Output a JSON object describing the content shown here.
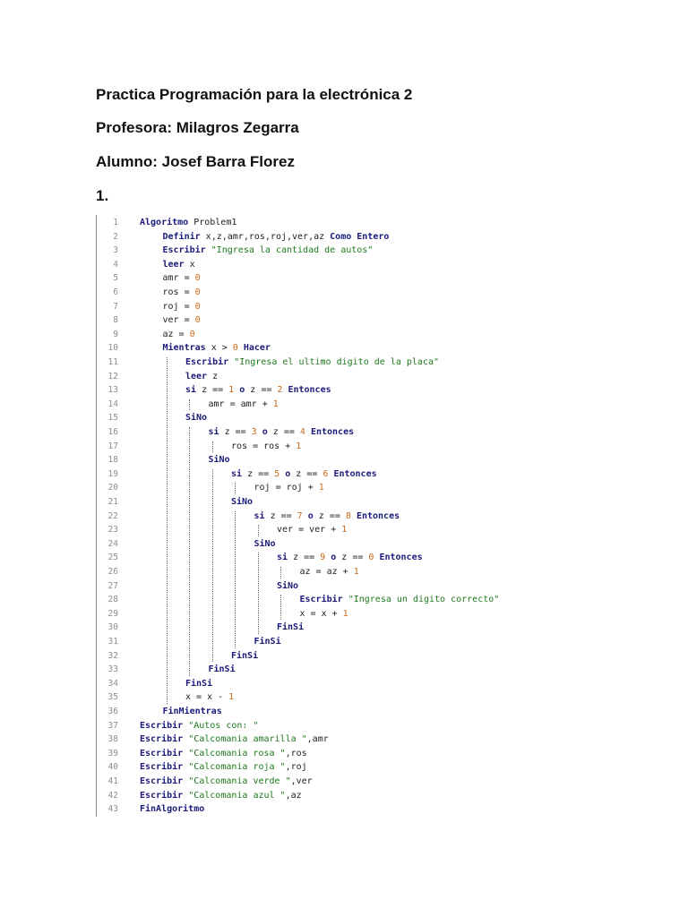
{
  "document": {
    "title": "Practica Programación para la electrónica 2",
    "teacher": "Profesora: Milagros Zegarra",
    "student": "Alumno: Josef Barra Florez",
    "item_number": "1."
  },
  "code": {
    "lines": [
      {
        "n": "1",
        "indent": 0,
        "tokens": [
          [
            "kw",
            "Algoritmo"
          ],
          [
            "id",
            " Problem1"
          ]
        ]
      },
      {
        "n": "2",
        "indent": 1,
        "tokens": [
          [
            "kw",
            "Definir"
          ],
          [
            "id",
            " x,z,amr,ros,roj,ver,az "
          ],
          [
            "kw",
            "Como Entero"
          ]
        ]
      },
      {
        "n": "3",
        "indent": 1,
        "tokens": [
          [
            "kw",
            "Escribir"
          ],
          [
            "id",
            " "
          ],
          [
            "str",
            "\"Ingresa la cantidad de autos\""
          ]
        ]
      },
      {
        "n": "4",
        "indent": 1,
        "tokens": [
          [
            "kw",
            "leer"
          ],
          [
            "id",
            " x"
          ]
        ]
      },
      {
        "n": "5",
        "indent": 1,
        "tokens": [
          [
            "id",
            "amr = "
          ],
          [
            "num",
            "0"
          ]
        ]
      },
      {
        "n": "6",
        "indent": 1,
        "tokens": [
          [
            "id",
            "ros = "
          ],
          [
            "num",
            "0"
          ]
        ]
      },
      {
        "n": "7",
        "indent": 1,
        "tokens": [
          [
            "id",
            "roj = "
          ],
          [
            "num",
            "0"
          ]
        ]
      },
      {
        "n": "8",
        "indent": 1,
        "tokens": [
          [
            "id",
            "ver = "
          ],
          [
            "num",
            "0"
          ]
        ]
      },
      {
        "n": "9",
        "indent": 1,
        "tokens": [
          [
            "id",
            "az = "
          ],
          [
            "num",
            "0"
          ]
        ]
      },
      {
        "n": "10",
        "indent": 1,
        "tokens": [
          [
            "kw",
            "Mientras"
          ],
          [
            "id",
            " x > "
          ],
          [
            "num",
            "0"
          ],
          [
            "id",
            " "
          ],
          [
            "kw",
            "Hacer"
          ]
        ]
      },
      {
        "n": "11",
        "indent": 2,
        "tokens": [
          [
            "kw",
            "Escribir"
          ],
          [
            "id",
            " "
          ],
          [
            "str",
            "\"Ingresa el ultimo digito de la placa\""
          ]
        ]
      },
      {
        "n": "12",
        "indent": 2,
        "tokens": [
          [
            "kw",
            "leer"
          ],
          [
            "id",
            " z"
          ]
        ]
      },
      {
        "n": "13",
        "indent": 2,
        "tokens": [
          [
            "kw",
            "si"
          ],
          [
            "id",
            " z == "
          ],
          [
            "num",
            "1"
          ],
          [
            "id",
            " "
          ],
          [
            "kw",
            "o"
          ],
          [
            "id",
            " z == "
          ],
          [
            "num",
            "2"
          ],
          [
            "id",
            " "
          ],
          [
            "kw",
            "Entonces"
          ]
        ]
      },
      {
        "n": "14",
        "indent": 3,
        "tokens": [
          [
            "id",
            "amr = amr + "
          ],
          [
            "num",
            "1"
          ]
        ]
      },
      {
        "n": "15",
        "indent": 2,
        "tokens": [
          [
            "kw",
            "SiNo"
          ]
        ]
      },
      {
        "n": "16",
        "indent": 3,
        "tokens": [
          [
            "kw",
            "si"
          ],
          [
            "id",
            " z == "
          ],
          [
            "num",
            "3"
          ],
          [
            "id",
            " "
          ],
          [
            "kw",
            "o"
          ],
          [
            "id",
            " z == "
          ],
          [
            "num",
            "4"
          ],
          [
            "id",
            " "
          ],
          [
            "kw",
            "Entonces"
          ]
        ]
      },
      {
        "n": "17",
        "indent": 4,
        "tokens": [
          [
            "id",
            "ros = ros + "
          ],
          [
            "num",
            "1"
          ]
        ]
      },
      {
        "n": "18",
        "indent": 3,
        "tokens": [
          [
            "kw",
            "SiNo"
          ]
        ]
      },
      {
        "n": "19",
        "indent": 4,
        "tokens": [
          [
            "kw",
            "si"
          ],
          [
            "id",
            " z == "
          ],
          [
            "num",
            "5"
          ],
          [
            "id",
            " "
          ],
          [
            "kw",
            "o"
          ],
          [
            "id",
            " z == "
          ],
          [
            "num",
            "6"
          ],
          [
            "id",
            " "
          ],
          [
            "kw",
            "Entonces"
          ]
        ]
      },
      {
        "n": "20",
        "indent": 5,
        "tokens": [
          [
            "id",
            "roj = roj + "
          ],
          [
            "num",
            "1"
          ]
        ]
      },
      {
        "n": "21",
        "indent": 4,
        "tokens": [
          [
            "kw",
            "SiNo"
          ]
        ]
      },
      {
        "n": "22",
        "indent": 5,
        "tokens": [
          [
            "kw",
            "si"
          ],
          [
            "id",
            " z == "
          ],
          [
            "num",
            "7"
          ],
          [
            "id",
            " "
          ],
          [
            "kw",
            "o"
          ],
          [
            "id",
            " z == "
          ],
          [
            "num",
            "8"
          ],
          [
            "id",
            " "
          ],
          [
            "kw",
            "Entonces"
          ]
        ]
      },
      {
        "n": "23",
        "indent": 6,
        "tokens": [
          [
            "id",
            "ver = ver + "
          ],
          [
            "num",
            "1"
          ]
        ]
      },
      {
        "n": "24",
        "indent": 5,
        "tokens": [
          [
            "kw",
            "SiNo"
          ]
        ]
      },
      {
        "n": "25",
        "indent": 6,
        "tokens": [
          [
            "kw",
            "si"
          ],
          [
            "id",
            " z == "
          ],
          [
            "num",
            "9"
          ],
          [
            "id",
            " "
          ],
          [
            "kw",
            "o"
          ],
          [
            "id",
            " z == "
          ],
          [
            "num",
            "0"
          ],
          [
            "id",
            " "
          ],
          [
            "kw",
            "Entonces"
          ]
        ]
      },
      {
        "n": "26",
        "indent": 7,
        "tokens": [
          [
            "id",
            "az = az + "
          ],
          [
            "num",
            "1"
          ]
        ]
      },
      {
        "n": "27",
        "indent": 6,
        "tokens": [
          [
            "kw",
            "SiNo"
          ]
        ]
      },
      {
        "n": "28",
        "indent": 7,
        "tokens": [
          [
            "kw",
            "Escribir"
          ],
          [
            "id",
            " "
          ],
          [
            "str",
            "\"Ingresa un digito correcto\""
          ]
        ]
      },
      {
        "n": "29",
        "indent": 7,
        "tokens": [
          [
            "id",
            "x = x + "
          ],
          [
            "num",
            "1"
          ]
        ]
      },
      {
        "n": "30",
        "indent": 6,
        "tokens": [
          [
            "kw",
            "FinSi"
          ]
        ]
      },
      {
        "n": "31",
        "indent": 5,
        "tokens": [
          [
            "kw",
            "FinSi"
          ]
        ]
      },
      {
        "n": "32",
        "indent": 4,
        "tokens": [
          [
            "kw",
            "FinSi"
          ]
        ]
      },
      {
        "n": "33",
        "indent": 3,
        "tokens": [
          [
            "kw",
            "FinSi"
          ]
        ]
      },
      {
        "n": "34",
        "indent": 2,
        "tokens": [
          [
            "kw",
            "FinSi"
          ]
        ]
      },
      {
        "n": "35",
        "indent": 2,
        "tokens": [
          [
            "id",
            "x = x - "
          ],
          [
            "num",
            "1"
          ]
        ]
      },
      {
        "n": "36",
        "indent": 1,
        "tokens": [
          [
            "kw",
            "FinMientras"
          ]
        ]
      },
      {
        "n": "37",
        "indent": 0,
        "tokens": [
          [
            "kw",
            "Escribir"
          ],
          [
            "id",
            " "
          ],
          [
            "str",
            "\"Autos con: \""
          ]
        ]
      },
      {
        "n": "38",
        "indent": 0,
        "tokens": [
          [
            "kw",
            "Escribir"
          ],
          [
            "id",
            " "
          ],
          [
            "str",
            "\"Calcomania amarilla \""
          ],
          [
            "id",
            ",amr"
          ]
        ]
      },
      {
        "n": "39",
        "indent": 0,
        "tokens": [
          [
            "kw",
            "Escribir"
          ],
          [
            "id",
            " "
          ],
          [
            "str",
            "\"Calcomania rosa \""
          ],
          [
            "id",
            ",ros"
          ]
        ]
      },
      {
        "n": "40",
        "indent": 0,
        "tokens": [
          [
            "kw",
            "Escribir"
          ],
          [
            "id",
            " "
          ],
          [
            "str",
            "\"Calcomania roja \""
          ],
          [
            "id",
            ",roj"
          ]
        ]
      },
      {
        "n": "41",
        "indent": 0,
        "tokens": [
          [
            "kw",
            "Escribir"
          ],
          [
            "id",
            " "
          ],
          [
            "str",
            "\"Calcomania verde \""
          ],
          [
            "id",
            ",ver"
          ]
        ]
      },
      {
        "n": "42",
        "indent": 0,
        "tokens": [
          [
            "kw",
            "Escribir"
          ],
          [
            "id",
            " "
          ],
          [
            "str",
            "\"Calcomania azul \""
          ],
          [
            "id",
            ",az"
          ]
        ]
      },
      {
        "n": "43",
        "indent": 0,
        "tokens": [
          [
            "kw",
            "FinAlgoritmo"
          ]
        ]
      }
    ]
  },
  "colors": {
    "keyword": "#1a1a7a",
    "string": "#1e7a1e",
    "number": "#c8691a",
    "line_number": "#8c8c8c"
  }
}
